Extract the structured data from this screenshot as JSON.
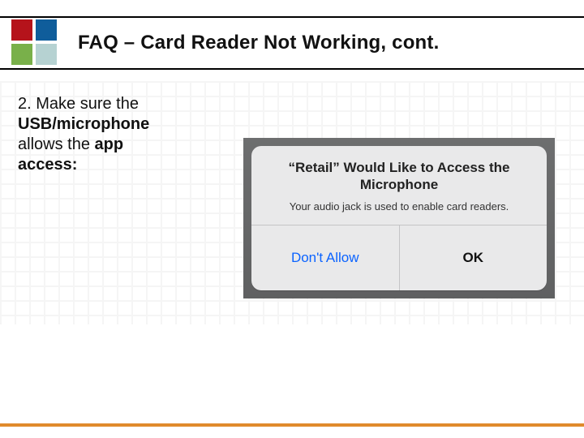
{
  "title": "FAQ – Card Reader Not Working, cont.",
  "step": {
    "prefix": "2. Make sure the ",
    "strong1": "USB/microphone",
    "mid": " allows the ",
    "strong2": "app access:"
  },
  "dialog": {
    "title": "“Retail” Would Like to Access the Microphone",
    "message": "Your audio jack is used to enable card readers.",
    "deny": "Don't Allow",
    "allow": "OK"
  },
  "colors": {
    "accent": "#e08a2c"
  }
}
